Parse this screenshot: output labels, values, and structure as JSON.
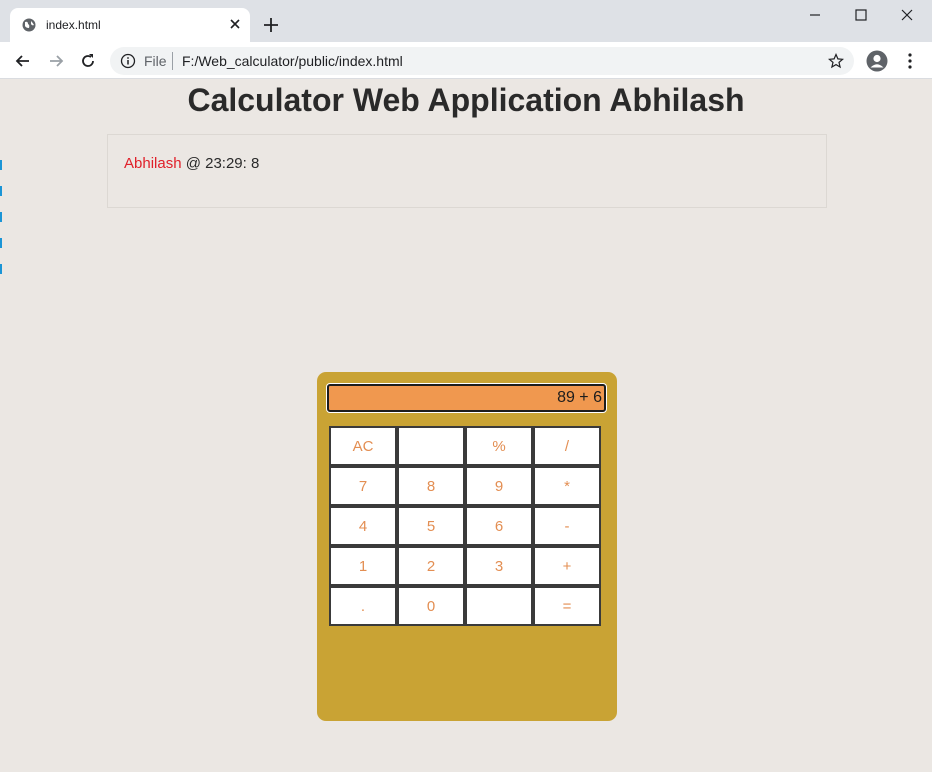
{
  "browser": {
    "tab_title": "index.html",
    "url_scheme": "File",
    "url": "F:/Web_calculator/public/index.html",
    "icons": [
      "globe-icon",
      "close-icon",
      "plus-icon",
      "minimize-icon",
      "maximize-icon",
      "window-close-icon",
      "back-arrow-icon",
      "forward-arrow-icon",
      "reload-icon",
      "info-icon",
      "star-icon",
      "profile-icon",
      "menu-dots-icon"
    ]
  },
  "page": {
    "title": "Calculator Web Application Abhilash",
    "info": {
      "name": "Abhilash",
      "rest": " @ 23:29: 8"
    }
  },
  "calculator": {
    "display": "89 + 6",
    "keys": [
      "AC",
      "",
      "%",
      "/",
      "7",
      "8",
      "9",
      "*",
      "4",
      "5",
      "6",
      "-",
      "1",
      "2",
      "3",
      "+",
      ".",
      "0",
      "",
      "="
    ]
  },
  "colors": {
    "page_bg": "#ebe7e3",
    "calc_bg": "#c9a334",
    "display_bg": "#f0984f",
    "key_text": "#e38e52",
    "name_red": "#e0202a"
  }
}
